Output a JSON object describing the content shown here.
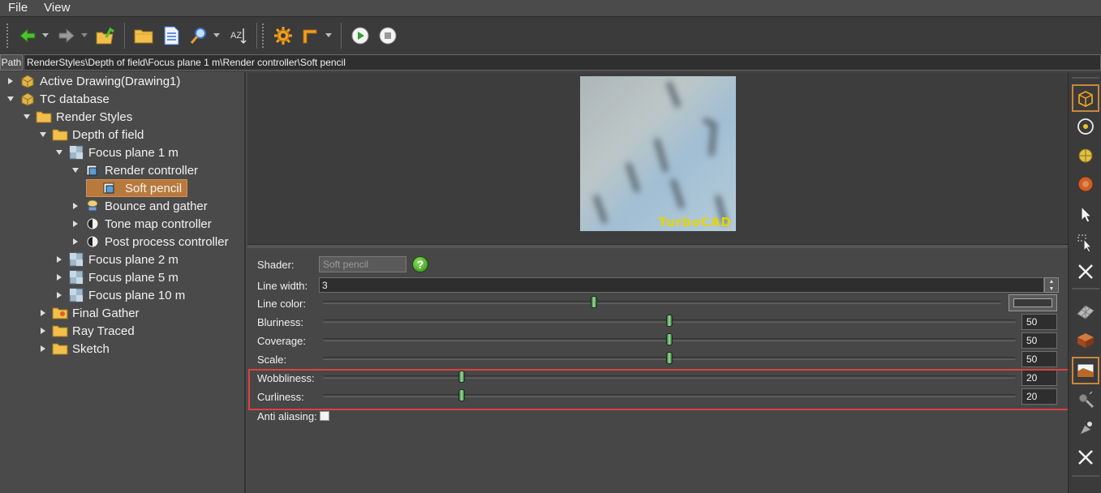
{
  "menu": {
    "file": "File",
    "view": "View"
  },
  "toolbar": {
    "back": "back-arrow-icon",
    "forward": "forward-arrow-icon",
    "up": "folder-up-icon",
    "open": "folder-icon",
    "document": "document-icon",
    "find": "find-icon",
    "sort": "sort-icon",
    "sort_text": "AZ",
    "settings": "gear-icon",
    "corner": "corner-icon",
    "play": "play-icon",
    "stop": "stop-icon"
  },
  "path": {
    "label": "Path",
    "value": "RenderStyles\\Depth of field\\Focus plane 1 m\\Render controller\\Soft pencil"
  },
  "tree": [
    {
      "label": "Active Drawing(Drawing1)",
      "level": 0,
      "state": "closed",
      "icon": "box"
    },
    {
      "label": "TC database",
      "level": 0,
      "state": "open",
      "icon": "box"
    },
    {
      "label": "Render Styles",
      "level": 1,
      "state": "open",
      "icon": "folder"
    },
    {
      "label": "Depth of field",
      "level": 2,
      "state": "open",
      "icon": "folder"
    },
    {
      "label": "Focus plane 1 m",
      "level": 3,
      "state": "open",
      "icon": "tile"
    },
    {
      "label": "Render controller",
      "level": 4,
      "state": "open",
      "icon": "render"
    },
    {
      "label": "Soft pencil",
      "level": 5,
      "state": "none",
      "icon": "render",
      "selected": true
    },
    {
      "label": "Bounce and gather",
      "level": 4,
      "state": "closed",
      "icon": "lamp"
    },
    {
      "label": "Tone map controller",
      "level": 4,
      "state": "closed",
      "icon": "half"
    },
    {
      "label": "Post process controller",
      "level": 4,
      "state": "closed",
      "icon": "half"
    },
    {
      "label": "Focus plane 2 m",
      "level": 3,
      "state": "closed",
      "icon": "tile"
    },
    {
      "label": "Focus plane 5 m",
      "level": 3,
      "state": "closed",
      "icon": "tile"
    },
    {
      "label": "Focus plane 10 m",
      "level": 3,
      "state": "closed",
      "icon": "tile"
    },
    {
      "label": "Final Gather",
      "level": 2,
      "state": "closed",
      "icon": "folder-special"
    },
    {
      "label": "Ray Traced",
      "level": 2,
      "state": "closed",
      "icon": "folder"
    },
    {
      "label": "Sketch",
      "level": 2,
      "state": "closed",
      "icon": "folder"
    }
  ],
  "preview": {
    "logo": "TurboCAD"
  },
  "props": {
    "shader_label": "Shader:",
    "shader_value": "Soft pencil",
    "help": "?",
    "line_width_label": "Line width:",
    "line_width_value": "3",
    "spin_up": "▲",
    "spin_down": "▼",
    "line_color_label": "Line color:",
    "line_color_level": 0.4,
    "sliders": [
      {
        "label": "Bluriness:",
        "value": "50",
        "level": 0.5
      },
      {
        "label": "Coverage:",
        "value": "50",
        "level": 0.5
      },
      {
        "label": "Scale:",
        "value": "50",
        "level": 0.5
      },
      {
        "label": "Wobbliness:",
        "value": "20",
        "level": 0.2
      },
      {
        "label": "Curliness:",
        "value": "20",
        "level": 0.2
      }
    ],
    "anti_aliasing_label": "Anti aliasing:"
  },
  "right_toolbar": [
    "cube-icon",
    "camera-orbit-icon",
    "sphere-icon",
    "material-icon",
    "pointer-icon",
    "select-pointer-icon",
    "close-icon",
    "grid-icon",
    "brick-icon",
    "landscape-icon",
    "light-icon",
    "render-icon",
    "close-icon"
  ]
}
